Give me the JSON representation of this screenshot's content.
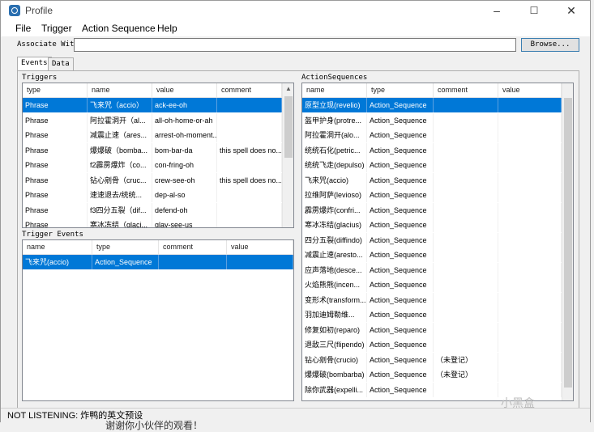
{
  "window": {
    "title": "Profile",
    "minimize": "–",
    "maximize": "☐",
    "close": "✕"
  },
  "menu": [
    "File",
    "Trigger",
    "Action Sequence",
    "Help"
  ],
  "associate": {
    "label": "Associate With",
    "value": "",
    "browse_label": "Browse..."
  },
  "tabs": [
    "Events",
    "Data"
  ],
  "triggers": {
    "label": "Triggers",
    "columns": [
      "type",
      "name",
      "value",
      "comment"
    ],
    "rows": [
      [
        "Phrase",
        "飞来咒（accio）",
        "ack-ee-oh",
        ""
      ],
      [
        "Phrase",
        "阿拉霍洞开（al...",
        "all-oh-home-or-ah",
        ""
      ],
      [
        "Phrase",
        "减震止速（ares...",
        "arrest-oh-moment...",
        ""
      ],
      [
        "Phrase",
        "爆爆破（bomba...",
        "bom-bar-da",
        "this spell does no..."
      ],
      [
        "Phrase",
        "f2霹雳爆炸（co...",
        "con-fring-oh",
        ""
      ],
      [
        "Phrase",
        "钻心剜骨（cruc...",
        "crew-see-oh",
        "this spell does no..."
      ],
      [
        "Phrase",
        "速速退去/统统...",
        "dep-al-so",
        ""
      ],
      [
        "Phrase",
        "f3四分五裂（dif...",
        "defend-oh",
        ""
      ],
      [
        "Phrase",
        "寒冰冻结（glaci...",
        "glay-see-us",
        ""
      ]
    ]
  },
  "trigger_events": {
    "label": "Trigger Events",
    "columns": [
      "name",
      "type",
      "comment",
      "value"
    ],
    "rows": [
      [
        "飞来咒(accio)",
        "Action_Sequence",
        "",
        ""
      ]
    ]
  },
  "action_sequences": {
    "label": "ActionSequences",
    "columns": [
      "name",
      "type",
      "comment",
      "value"
    ],
    "rows": [
      [
        "原型立现(revelio)",
        "Action_Sequence",
        "",
        ""
      ],
      [
        "盔甲护身(protre...",
        "Action_Sequence",
        "",
        ""
      ],
      [
        "阿拉霍洞开(alo...",
        "Action_Sequence",
        "",
        ""
      ],
      [
        "统统石化(petric...",
        "Action_Sequence",
        "",
        ""
      ],
      [
        "统统飞走(depulso)",
        "Action_Sequence",
        "",
        ""
      ],
      [
        "飞来咒(accio)",
        "Action_Sequence",
        "",
        ""
      ],
      [
        "拉维阿萨(levioso)",
        "Action_Sequence",
        "",
        ""
      ],
      [
        "霹雳爆炸(confri...",
        "Action_Sequence",
        "",
        ""
      ],
      [
        "寒冰冻结(glacius)",
        "Action_Sequence",
        "",
        ""
      ],
      [
        "四分五裂(diffindo)",
        "Action_Sequence",
        "",
        ""
      ],
      [
        "减震止速(aresto...",
        "Action_Sequence",
        "",
        ""
      ],
      [
        "应声落地(desce...",
        "Action_Sequence",
        "",
        ""
      ],
      [
        "火焰熊熊(incen...",
        "Action_Sequence",
        "",
        ""
      ],
      [
        "变形术(transform...",
        "Action_Sequence",
        "",
        ""
      ],
      [
        "羽加迪姆勒维...",
        "Action_Sequence",
        "",
        ""
      ],
      [
        "修复如初(reparo)",
        "Action_Sequence",
        "",
        ""
      ],
      [
        "退敌三尺(flipendo)",
        "Action_Sequence",
        "",
        ""
      ],
      [
        "钻心剜骨(crucio)",
        "Action_Sequence",
        "（未登记）",
        ""
      ],
      [
        "爆爆破(bombarba)",
        "Action_Sequence",
        "（未登记）",
        ""
      ],
      [
        "除你武器(expelli...",
        "Action_Sequence",
        "",
        ""
      ]
    ]
  },
  "status": {
    "text": "NOT LISTENING:  炸鸭的英文预设"
  },
  "watermark": "小黑盒",
  "background_fragment": "谢谢你小伙伴的观看！"
}
